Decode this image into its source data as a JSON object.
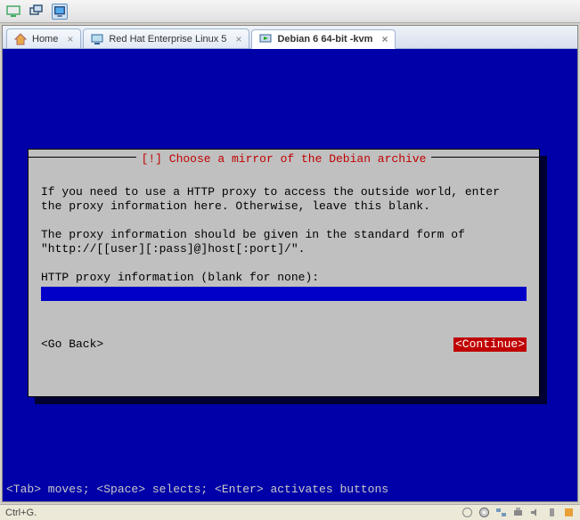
{
  "toolbar": {
    "icon1": "monitor-icon",
    "icon2": "duplicate-icon",
    "icon3": "fullscreen-icon"
  },
  "tabs": [
    {
      "label": "Home",
      "icon": "home-icon"
    },
    {
      "label": "Red Hat Enterprise Linux 5",
      "icon": "vm-icon"
    },
    {
      "label": "Debian 6 64-bit -kvm",
      "icon": "vm-play-icon",
      "active": true
    }
  ],
  "installer": {
    "title": "[!] Choose a mirror of the Debian archive",
    "para1": "If you need to use a HTTP proxy to access the outside world, enter the proxy information here. Otherwise, leave this blank.",
    "para2": "The proxy information should be given in the standard form of \"http://[[user][:pass]@]host[:port]/\".",
    "prompt": "HTTP proxy information (blank for none):",
    "input_value": "",
    "go_back": "<Go Back>",
    "continue": "<Continue>"
  },
  "hint": "<Tab> moves; <Space> selects; <Enter> activates buttons",
  "status": {
    "text": "Ctrl+G."
  }
}
